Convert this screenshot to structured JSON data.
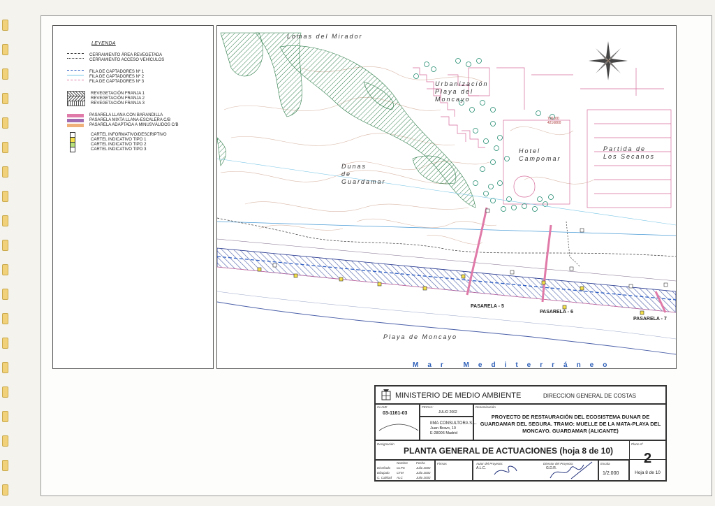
{
  "legend": {
    "title": "LEYENDA",
    "items": [
      {
        "label": "CERRAMIENTO ÁREA REVEGETADA",
        "symbol": "dashdot-line"
      },
      {
        "label": "CERRAMIENTO ACCESO VEHÍCULOS",
        "symbol": "dotted-line"
      },
      {
        "label": "FILA DE CAPTADORES Nº 1",
        "symbol": "blue-dashed-line",
        "color": "#2f5fc4"
      },
      {
        "label": "FILA DE CAPTADORES Nº 2",
        "symbol": "cyan-line",
        "color": "#74c6e6"
      },
      {
        "label": "FILA DE CAPTADORES Nº 3",
        "symbol": "pink-dashed-line",
        "color": "#e07aa8"
      },
      {
        "label": "REVEGETACIÓN FRANJA 1",
        "symbol": "hatch-diagonal"
      },
      {
        "label": "REVEGETACIÓN FRANJA 2",
        "symbol": "hatch-cross"
      },
      {
        "label": "REVEGETACIÓN FRANJA 3",
        "symbol": "hatch-vertical"
      },
      {
        "label": "PASARELA LLANA CON BARANDILLA",
        "symbol": "fill",
        "color": "#e07aa8"
      },
      {
        "label": "PASARELA MIXTA LLANA-ESCALERA C/B",
        "symbol": "fill",
        "color": "#a06bb0"
      },
      {
        "label": "PASARELA ADAPTADA A MINUSVÁLIDOS C/B",
        "symbol": "fill",
        "color": "#f0b07a"
      },
      {
        "label": "CARTEL INFORMATIVO/DESCRIPTIVO",
        "symbol": "square",
        "color": "#ffffff"
      },
      {
        "label": "CARTEL INDICATIVO TIPO 1",
        "symbol": "square",
        "color": "#f5e04a"
      },
      {
        "label": "CARTEL INDICATIVO TIPO 2",
        "symbol": "square",
        "color": "#b7e07a"
      },
      {
        "label": "CARTEL INDICATIVO TIPO 3",
        "symbol": "square",
        "color": "#ffffff"
      }
    ]
  },
  "map": {
    "labels": {
      "lomas": "Lomas del Mirador",
      "urbanizacion1": "Urbanización",
      "urbanizacion2": "Playa del",
      "urbanizacion3": "Moncayo",
      "hotel1": "Hotel",
      "hotel2": "Campomar",
      "partida1": "Partida de",
      "partida2": "Los Secanos",
      "dunas1": "Dunas",
      "dunas2": "de",
      "dunas3": "Guardamar",
      "playa": "Playa de Moncayo",
      "mar": "Mar Mediterráneo",
      "coord1": "706100",
      "coord2": "4216800"
    },
    "pasarelas": [
      "PASARELA - 5",
      "PASARELA - 6",
      "PASARELA - 7"
    ],
    "compass_icon": "compass-rose-icon"
  },
  "titleblock": {
    "ministerio": "MINISTERIO DE MEDIO AMBIENTE",
    "direccion": "DIRECCION GENERAL DE COSTAS",
    "clave_caption": "CLAVE",
    "clave": "03-1161-03",
    "fecha_caption": "FECHA:",
    "fecha": "JULIO 2002",
    "denominacion_caption": "Denominación",
    "proyecto": "PROYECTO DE RESTAURACIÓN DEL ECOSISTEMA DUNAR DE GUARDAMAR DEL SEGURA. TRAMO: MUELLE DE LA MATA-PLAYA DEL MONCAYO. GUARDAMAR (ALICANTE)",
    "consultora": "IIMA CONSULTORA S.L.",
    "direccion_consultora1": "Juan Bravo, 10",
    "direccion_consultora2": "E-28006 Madrid",
    "designacion_caption": "Designación",
    "plano_title": "PLANTA GENERAL DE ACTUACIONES (hoja 8 de 10)",
    "plano_caption": "Plano nº",
    "plano_num": "2",
    "hoja": "Hoja 8 de 10",
    "escala_caption": "Escala",
    "escala": "1/2.000",
    "firmas_caption": "Firmas",
    "autor_caption": "Autor del Proyecto:",
    "autor": "A.L.C.",
    "director_caption": "Director del Proyecto:",
    "director": "G.D.R.",
    "tabla": {
      "headers": [
        "",
        "Nombre",
        "Fecha"
      ],
      "rows": [
        [
          "Diseñado",
          "CLPS",
          "Julio 2002"
        ],
        [
          "Dibujado",
          "CTM",
          "Julio 2002"
        ],
        [
          "C. Calidad",
          "ALC",
          "Julio 2002"
        ]
      ]
    }
  }
}
